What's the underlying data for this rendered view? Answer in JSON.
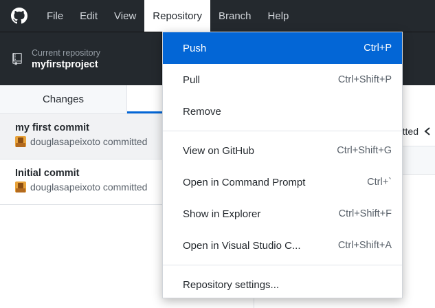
{
  "menubar": {
    "items": [
      {
        "label": "File"
      },
      {
        "label": "Edit"
      },
      {
        "label": "View"
      },
      {
        "label": "Repository"
      },
      {
        "label": "Branch"
      },
      {
        "label": "Help"
      }
    ],
    "open_menu": "Repository"
  },
  "toolbar": {
    "caption": "Current repository",
    "repo_name": "myfirstproject"
  },
  "tabs": {
    "changes": "Changes",
    "history": ""
  },
  "commits": [
    {
      "title": "my first commit",
      "author": "douglasapeixoto committed"
    },
    {
      "title": "Initial commit",
      "author": "douglasapeixoto committed"
    }
  ],
  "right_pane": {
    "header_fragment": "tted"
  },
  "dropdown": {
    "group1": [
      {
        "label": "Push",
        "shortcut": "Ctrl+P",
        "active": true
      },
      {
        "label": "Pull",
        "shortcut": "Ctrl+Shift+P"
      },
      {
        "label": "Remove",
        "shortcut": ""
      }
    ],
    "group2": [
      {
        "label": "View on GitHub",
        "shortcut": "Ctrl+Shift+G"
      },
      {
        "label": "Open in Command Prompt",
        "shortcut": "Ctrl+`"
      },
      {
        "label": "Show in Explorer",
        "shortcut": "Ctrl+Shift+F"
      },
      {
        "label": "Open in Visual Studio C...",
        "shortcut": "Ctrl+Shift+A"
      }
    ],
    "group3": [
      {
        "label": "Repository settings...",
        "shortcut": ""
      }
    ]
  },
  "colors": {
    "dark_bg": "#24292e",
    "accent": "#0366d6"
  },
  "icons": {
    "logo": "github-mark-icon",
    "repo": "repository-book-icon",
    "share": "share-icon"
  }
}
